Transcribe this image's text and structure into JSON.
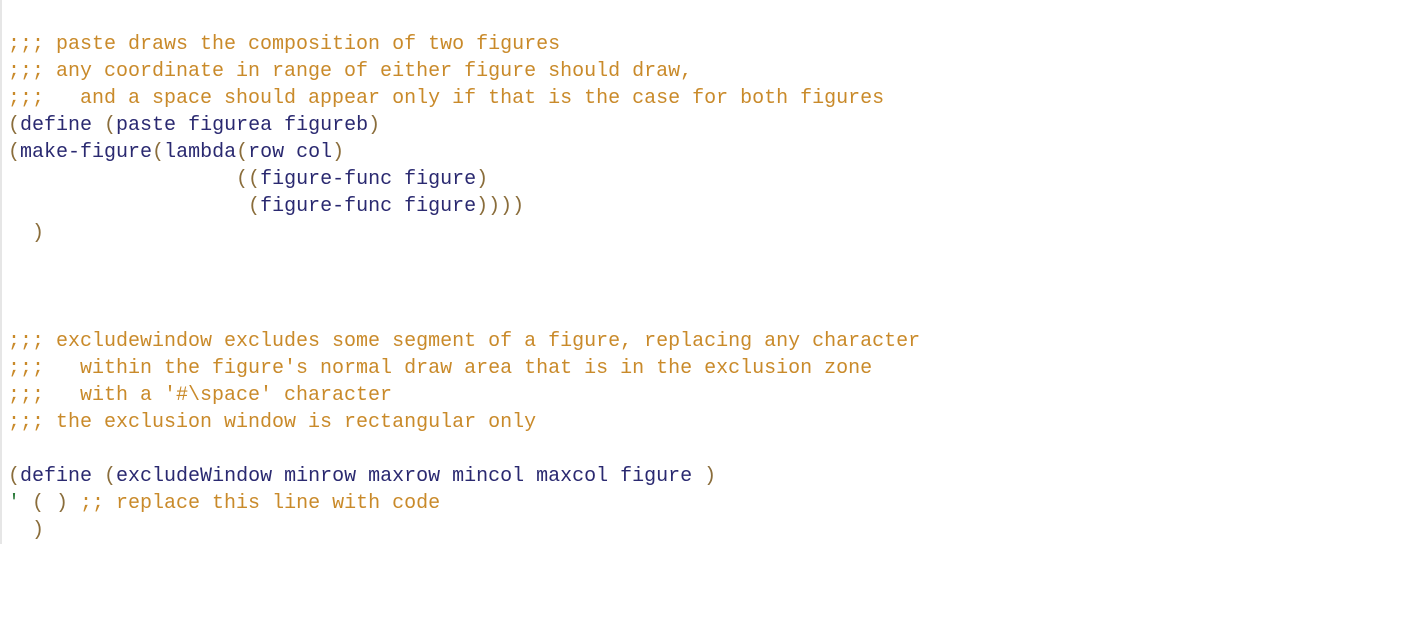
{
  "code": {
    "paste": {
      "comment_lines": [
        ";;; paste draws the composition of two figures",
        ";;; any coordinate in range of either figure should draw,",
        ";;;   and a space should appear only if that is the case for both figures"
      ],
      "define_head_open": "(",
      "define_kw": "define",
      "define_head_after_kw": " (",
      "define_name": "paste",
      "define_params": " figurea figureb",
      "define_head_close": ")",
      "body_line1_a": "(",
      "body_line1_b": "make-figure",
      "body_line1_c": "(",
      "body_line1_d": "lambda",
      "body_line1_e": "(",
      "body_line1_f": "row col",
      "body_line1_g": ")",
      "body_line2_pad": "                   ",
      "body_line2_a": "((",
      "body_line2_b": "figure-func figure",
      "body_line2_c": ")",
      "body_line3_pad": "                    ",
      "body_line3_a": "(",
      "body_line3_b": "figure-func figure",
      "body_line3_c": "))))",
      "body_close_pad": "  ",
      "body_close": ")"
    },
    "excludewindow": {
      "comment_lines": [
        ";;; excludewindow excludes some segment of a figure, replacing any character",
        ";;;   within the figure's normal draw area that is in the exclusion zone",
        ";;;   with a '#\\space' character",
        ";;; the exclusion window is rectangular only"
      ],
      "define_head_open": "(",
      "define_kw": "define",
      "define_head_after_kw": " (",
      "define_name": "excludeWindow",
      "define_params": " minrow maxrow mincol maxcol figure ",
      "define_head_close": ")",
      "placeholder_quote": "'",
      "placeholder_parens": " ( ) ",
      "placeholder_comment": ";; replace this line with code",
      "close_pad": "  ",
      "close": ")"
    }
  }
}
